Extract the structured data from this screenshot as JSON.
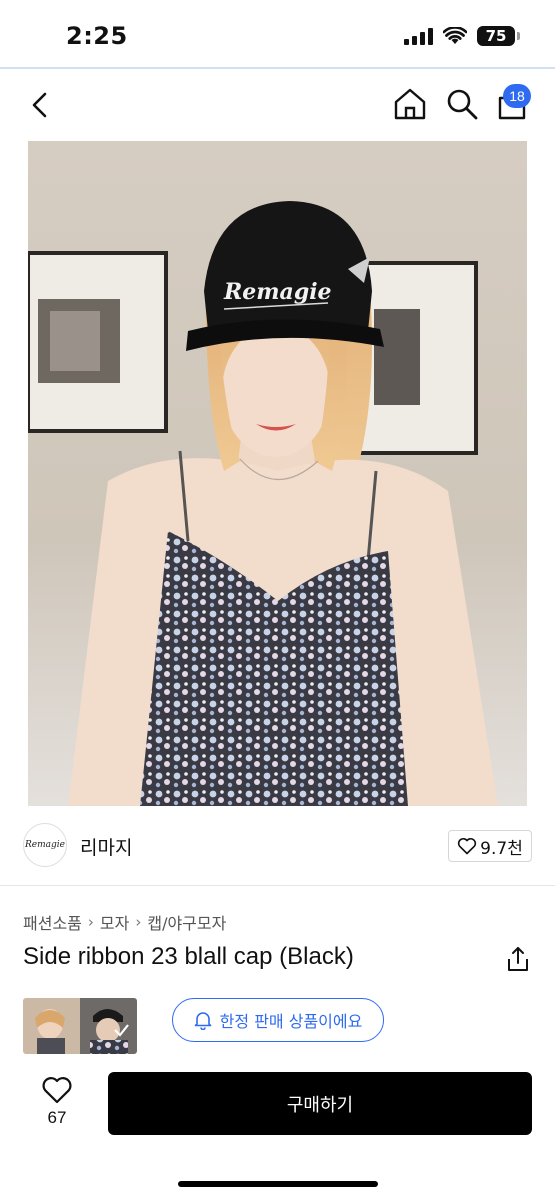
{
  "status_bar": {
    "time": "2:25",
    "battery": "75"
  },
  "nav": {
    "cart_count": "18"
  },
  "shop": {
    "name": "리마지",
    "logo_text": "Remagie",
    "likes": "9.7천"
  },
  "photo": {
    "cap_text": "Remagie"
  },
  "breadcrumb": [
    "패션소품",
    "모자",
    "캡/야구모자"
  ],
  "product": {
    "title": "Side ribbon 23 blall cap (Black)"
  },
  "limited_badge": "한정 판매 상품이에요",
  "bottom": {
    "wish_count": "67",
    "buy_label": "구매하기"
  },
  "colors": {
    "accent": "#2f6bf0",
    "buy_button": "#000000"
  }
}
